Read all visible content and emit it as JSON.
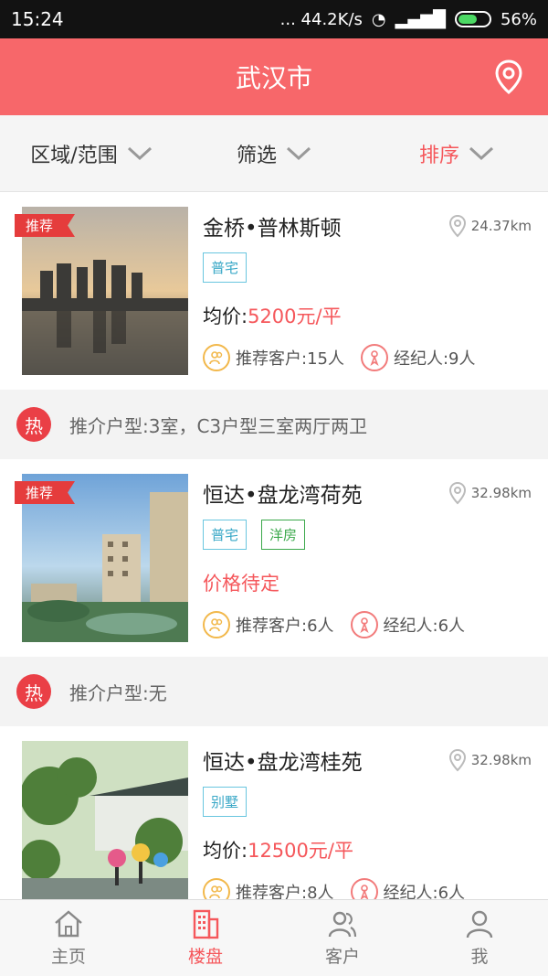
{
  "status": {
    "time": "15:24",
    "net": "... 44.2K/s",
    "battery": "56%"
  },
  "header": {
    "city": "武汉市",
    "location_icon": "map-pin-icon"
  },
  "filters": [
    {
      "label": "区域/范围",
      "active": false
    },
    {
      "label": "筛选",
      "active": false
    },
    {
      "label": "排序",
      "active": true
    }
  ],
  "accent": "#f7676a",
  "listings": [
    {
      "ribbon": "推荐",
      "title": "金桥•普林斯顿",
      "distance": "24.37km",
      "tags": [
        "普宅"
      ],
      "price_prefix": "均价:",
      "price": "5200元/平",
      "referrals": "推荐客户:15人",
      "agents": "经纪人:9人",
      "hot": "推介户型:3室，C3户型三室两厅两卫"
    },
    {
      "ribbon": "推荐",
      "title": "恒达•盘龙湾荷苑",
      "distance": "32.98km",
      "tags": [
        "普宅",
        "洋房"
      ],
      "price_pending": "价格待定",
      "referrals": "推荐客户:6人",
      "agents": "经纪人:6人",
      "hot": "推介户型:无"
    },
    {
      "title": "恒达•盘龙湾桂苑",
      "distance": "32.98km",
      "tags": [
        "别墅"
      ],
      "price_prefix": "均价:",
      "price": "12500元/平",
      "referrals": "推荐客户:8人",
      "agents": "经纪人:6人"
    }
  ],
  "hot_badge": "热",
  "tabbar": [
    {
      "label": "主页",
      "icon": "home-icon",
      "active": false
    },
    {
      "label": "楼盘",
      "icon": "building-icon",
      "active": true
    },
    {
      "label": "客户",
      "icon": "customers-icon",
      "active": false
    },
    {
      "label": "我",
      "icon": "user-icon",
      "active": false
    }
  ]
}
